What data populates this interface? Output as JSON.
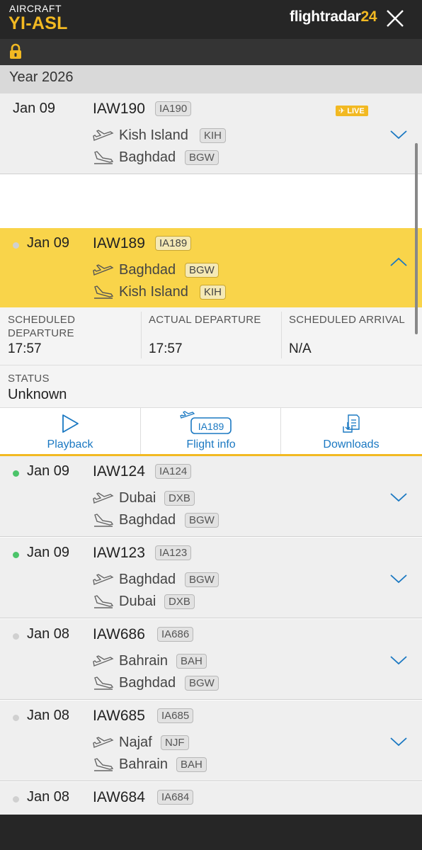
{
  "header": {
    "label": "AIRCRAFT",
    "registration": "YI-ASL",
    "brand": "flightradar",
    "brand_num": "24"
  },
  "year_label": "Year 2026",
  "flights": [
    {
      "date": "Jan 09",
      "flight": "IAW190",
      "code": "IA190",
      "live": "LIVE",
      "from_city": "Kish Island",
      "from_code": "KIH",
      "to_city": "Baghdad",
      "to_code": "BGW"
    },
    {
      "date": "Jan 09",
      "flight": "IAW189",
      "code": "IA189",
      "from_city": "Baghdad",
      "from_code": "BGW",
      "to_city": "Kish Island",
      "to_code": "KIH"
    },
    {
      "date": "Jan 09",
      "flight": "IAW124",
      "code": "IA124",
      "from_city": "Dubai",
      "from_code": "DXB",
      "to_city": "Baghdad",
      "to_code": "BGW"
    },
    {
      "date": "Jan 09",
      "flight": "IAW123",
      "code": "IA123",
      "from_city": "Baghdad",
      "from_code": "BGW",
      "to_city": "Dubai",
      "to_code": "DXB"
    },
    {
      "date": "Jan 08",
      "flight": "IAW686",
      "code": "IA686",
      "from_city": "Bahrain",
      "from_code": "BAH",
      "to_city": "Baghdad",
      "to_code": "BGW"
    },
    {
      "date": "Jan 08",
      "flight": "IAW685",
      "code": "IA685",
      "from_city": "Najaf",
      "from_code": "NJF",
      "to_city": "Bahrain",
      "to_code": "BAH"
    },
    {
      "date": "Jan 08",
      "flight": "IAW684",
      "code": "IA684"
    }
  ],
  "details": {
    "sched_dep_label_1": "SCHEDULED",
    "sched_dep_label_2": "DEPARTURE",
    "sched_dep_value": "17:57",
    "actual_dep_label": "ACTUAL DEPARTURE",
    "actual_dep_value": "17:57",
    "sched_arr_label": "SCHEDULED ARRIVAL",
    "sched_arr_value": "N/A",
    "status_label": "STATUS",
    "status_value": "Unknown",
    "playback_label": "Playback",
    "flight_info_label": "Flight info",
    "flight_info_badge": "IA189",
    "downloads_label": "Downloads"
  },
  "colors": {
    "accent": "#f2b922",
    "active_row": "#f9d44a",
    "link": "#1a78c2",
    "live_dot": "#4cc46a"
  }
}
